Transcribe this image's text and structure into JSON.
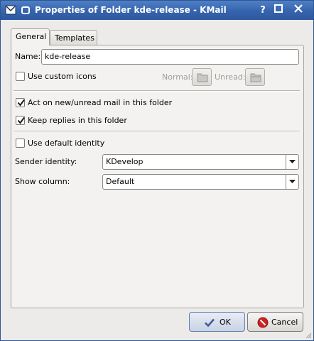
{
  "window": {
    "title": "Properties of Folder kde-release - KMail",
    "help_glyph": "?",
    "colors": {
      "titlebar": "#3564ad",
      "accent": "#cc2222",
      "check": "#1a1a1a"
    }
  },
  "tabs": [
    {
      "label": "General",
      "active": true
    },
    {
      "label": "Templates",
      "active": false
    }
  ],
  "general": {
    "name_label": "Name:",
    "name_value": "kde-release",
    "use_custom_icons_label": "Use custom icons",
    "use_custom_icons_checked": false,
    "normal_label": "Normal:",
    "unread_label": "Unread:",
    "act_on_new_label": "Act on new/unread mail in this folder",
    "act_on_new_checked": true,
    "keep_replies_label": "Keep replies in this folder",
    "keep_replies_checked": true,
    "use_default_identity_label": "Use default identity",
    "use_default_identity_checked": false,
    "sender_identity_label": "Sender identity:",
    "sender_identity_value": "KDevelop",
    "show_column_label": "Show column:",
    "show_column_value": "Default"
  },
  "buttons": {
    "ok_label": "OK",
    "cancel_label": "Cancel"
  }
}
